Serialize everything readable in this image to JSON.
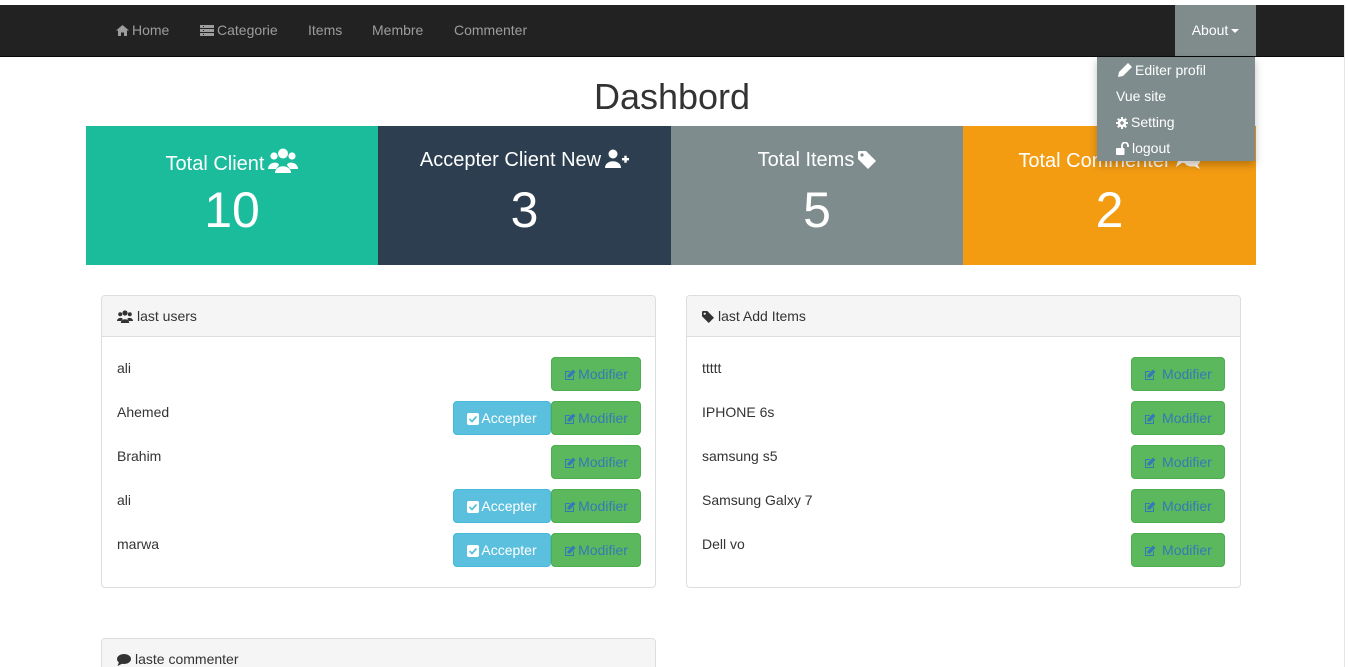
{
  "navbar": {
    "home": "Home",
    "categorie": "Categorie",
    "items": "Items",
    "membre": "Membre",
    "commenter": "Commenter",
    "about": "About"
  },
  "dropdown": {
    "editer": "Editer profil",
    "vue": "Vue site",
    "setting": "Setting",
    "logout": "logout"
  },
  "page_title": "Dashbord",
  "stats": [
    {
      "label": "Total Client",
      "value": "10",
      "color": "#1abc9c",
      "icon": "users-icon"
    },
    {
      "label": "Accepter Client New",
      "value": "3",
      "color": "#2c3e50",
      "icon": "user-plus-icon"
    },
    {
      "label": "Total Items",
      "value": "5",
      "color": "#7f8c8d",
      "icon": "tag-icon"
    },
    {
      "label": "Total Commenter",
      "value": "2",
      "color": "#f39c12",
      "icon": "comments-icon"
    }
  ],
  "last_users": {
    "title": "last users",
    "rows": [
      {
        "name": "ali",
        "accept": ""
      },
      {
        "name": "Ahemed",
        "accept": "Accepter"
      },
      {
        "name": "Brahim",
        "accept": ""
      },
      {
        "name": "ali",
        "accept": "Accepter"
      },
      {
        "name": "marwa",
        "accept": "Accepter"
      }
    ],
    "modifier_label": "Modifier"
  },
  "last_items": {
    "title": "last Add Items",
    "rows": [
      {
        "name": "ttttt"
      },
      {
        "name": "IPHONE 6s"
      },
      {
        "name": "samsung s5"
      },
      {
        "name": "Samsung Galxy 7"
      },
      {
        "name": "Dell vo"
      }
    ],
    "modifier_label": "Modifier"
  },
  "comments_panel": {
    "title": "laste commenter"
  }
}
